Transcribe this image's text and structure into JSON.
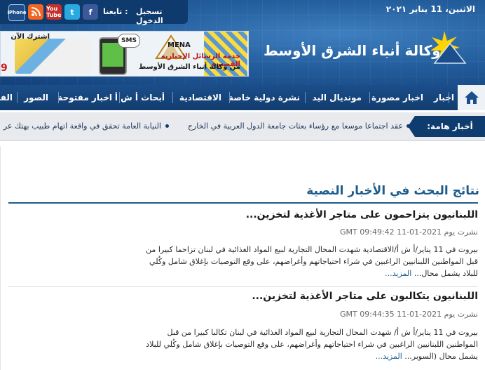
{
  "header": {
    "date_day": "الاثنين",
    "date_rest": "، 11 يناير ٢٠٢١",
    "login": "تسجيل الدخول",
    "follow_us": "تابعنا :",
    "social": {
      "facebook": "f",
      "twitter": "t",
      "youtube": "You Tube",
      "rss": "RSS",
      "iphone": "iPhone"
    },
    "logo_text": "وكالة أنباء الشرق الأوسط",
    "banner": {
      "mena_title": "MENA",
      "line1": "خدمة الرسائل الإخبارية القصيرة",
      "line2": "من وكالة أنباء الشرق الأوسط",
      "sms": "SMS",
      "subscribe": "اشترك الآن",
      "digit": "9"
    }
  },
  "nav": {
    "items": [
      "اخبار",
      "اخبار مصورة",
      "مونديال اليد",
      "نشرة دولية خاصة",
      "الاقتصادية",
      "أبحاث أ ش أ",
      "اخبار مفتوحة",
      "الصور",
      "الفي"
    ]
  },
  "breaking": {
    "label": "أخبار هامة:",
    "items": [
      "عقد اجتماعا موسعا مع رؤساء بعثات جامعة الدول العربية في الخارج",
      "النيابة العامة تحقق في واقعة اتهام طبيب بهتك عر"
    ]
  },
  "main": {
    "section_title": "نتائج البحث في الأخبار النصية",
    "results": [
      {
        "title": "اللبنانيون يتزاحمون على متاجر الأغذية لتخزين...",
        "date": "نشرت يوم 2021-01-11 09:49:42 GMT",
        "body": "بيروت في 11 يناير/أ ش أ/الاقتصادية شهدت المحال التجارية لبيع المواد الغذائية في لبنان تزاحما كبيرا من قبل المواطنين اللبنانيين الراغبين في شراء احتياجاتهم وأغراضهم، على وقع التوصيات بإغلاق شامل وكُلي للبلاد يشمل محال...",
        "more": "المزيد..."
      },
      {
        "title": "اللبنانيون يتكالبون على متاجر الأغذية لتخزين...",
        "date": "نشرت يوم 2021-01-11 09:44:35 GMT",
        "body": "بيروت في 11 يناير/أ ش أ/ شهدت المحال التجارية لبيع المواد الغذائية في لبنان تكالبا كبيرا من قبل المواطنين اللبنانيين الراغبين في شراء احتياجاتهم وأغراضهم، على وقع التوصيات بإغلاق شامل وكُلي للبلاد يشمل محال (السوبر...",
        "more": "المزيد..."
      }
    ]
  }
}
